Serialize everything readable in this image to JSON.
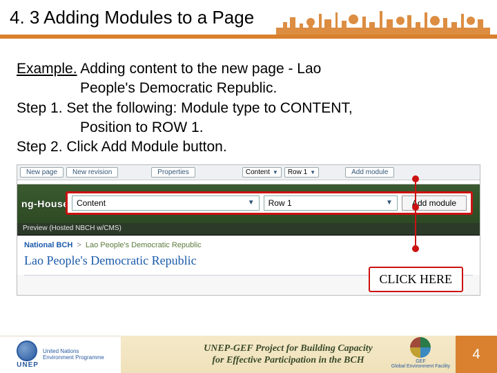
{
  "header": {
    "title": "4. 3 Adding Modules to a Page"
  },
  "body": {
    "example_label": "Example.",
    "example_text": " Adding content to the new page - Lao",
    "example_cont": "People's Democratic Republic.",
    "step1_label": "Step 1. ",
    "step1_text": "Set the following: Module type to CONTENT,",
    "step1_cont": "Position to ROW 1.",
    "step2_label": "Step 2. ",
    "step2_text": "Click Add Module button."
  },
  "screenshot": {
    "toolbar": {
      "new_page": "New page",
      "new_revision": "New revision",
      "properties": "Properties",
      "module_type_small": "Content",
      "position_small": "Row 1",
      "add_module_small": "Add module"
    },
    "banner_label": "ng-House I",
    "highlight": {
      "module_type": "Content",
      "position": "Row 1",
      "add_module": "Add module"
    },
    "preview_tab": "Preview (Hosted NBCH w/CMS)",
    "breadcrumb": {
      "part1": "National BCH",
      "part2": "Lao People's Democratic Republic"
    },
    "page_title": "Lao People's Democratic Republic",
    "callout": "CLICK HERE"
  },
  "footer": {
    "unep_label": "UNEP",
    "unep_sub": "United Nations\nEnvironment Programme",
    "center_line1": "UNEP-GEF Project for Building Capacity",
    "center_line2": "for Effective Participation in the BCH",
    "gef_line1": "GEF",
    "gef_line2": "Global Environment Facility",
    "page_number": "4"
  }
}
